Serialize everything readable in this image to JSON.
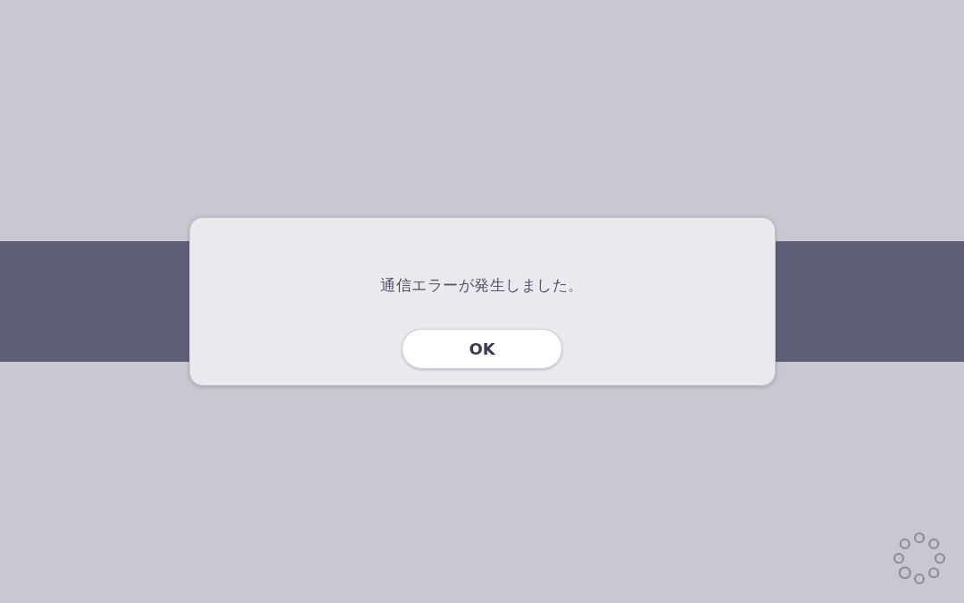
{
  "dialog": {
    "message": "通信エラーが発生しました。",
    "buttons": [
      {
        "label": "OK"
      }
    ]
  }
}
